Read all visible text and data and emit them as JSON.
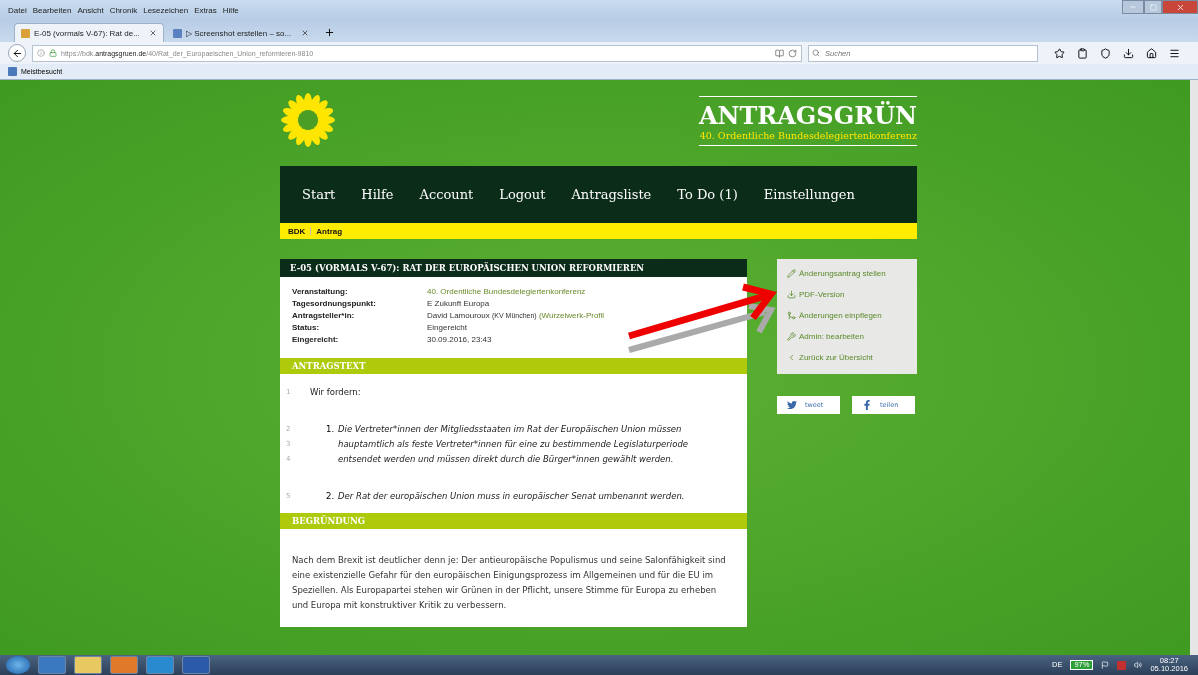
{
  "browser": {
    "menu": [
      "Datei",
      "Bearbeiten",
      "Ansicht",
      "Chronik",
      "Lesezeichen",
      "Extras",
      "Hilfe"
    ],
    "tabs": [
      {
        "label": "E-05 (vormals V-67): Rat de...",
        "selected": true
      },
      {
        "label": "▷ Screenshot erstellen – so...",
        "selected": false
      }
    ],
    "url": "https://bdk.**antragsgruen.de**/40/Rat_der_Europaeischen_Union_reformieren-9810",
    "search": {
      "placeholder": "Suchen"
    },
    "bookmarks": [
      "Meistbesucht"
    ]
  },
  "site": {
    "title": "ANTRAGSGRÜN",
    "subtitle": "40. Ordentliche Bundesdelegiertenkonferenz",
    "nav": [
      "Start",
      "Hilfe",
      "Account",
      "Logout",
      "Antragsliste",
      "To Do (1)",
      "Einstellungen"
    ],
    "breadcrumb": [
      "BDK",
      "Antrag"
    ],
    "motion": {
      "title": "E-05 (VORMALS V-67): RAT DER EUROPÄISCHEN UNION REFORMIEREN",
      "meta": [
        {
          "label": "Veranstaltung:",
          "value": "40. Ordentliche Bundesdelegiertenkonferenz",
          "kind": "link"
        },
        {
          "label": "Tagesordnungspunkt:",
          "value": "E Zukunft Europa",
          "kind": "text"
        },
        {
          "label": "Antragsteller*in:",
          "value": "David Lamouroux",
          "note": "(KV München)",
          "link": "(Wurzelwerk-Profil",
          "kind": "person"
        },
        {
          "label": "Status:",
          "value": "Eingereicht",
          "kind": "text"
        },
        {
          "label": "Eingereicht:",
          "value": "30.09.2016, 23:43",
          "kind": "text"
        }
      ],
      "text_heading": "ANTRAGSTEXT",
      "paragraphs": [
        {
          "kind": "plain",
          "lines": [
            {
              "number": "1",
              "text": "Wir fordern:"
            }
          ]
        },
        {
          "kind": "item",
          "marker": "1.",
          "lines": [
            {
              "number": "2",
              "text": "Die Vertreter*innen der Mitgliedsstaaten im Rat der Europäischen Union müssen"
            },
            {
              "number": "3",
              "text": "hauptamtlich als feste Vertreter*innen für eine zu bestimmende Legislaturperiode"
            },
            {
              "number": "4",
              "text": "entsendet werden und müssen direkt durch die Bürger*innen gewählt werden."
            }
          ]
        },
        {
          "kind": "item",
          "marker": "2.",
          "lines": [
            {
              "number": "5",
              "text": "Der Rat der europäischen Union muss in europäischer Senat umbenannt werden."
            }
          ]
        }
      ],
      "reason_heading": "BEGRÜNDUNG",
      "reason": "Nach dem Brexit ist deutlicher denn je: Der antieuropäische Populismus und seine Salonfähigkeit sind eine existenzielle Gefahr für den europäischen Einigungsprozess im Allgemeinen und für die EU im Speziellen. Als Europapartei stehen wir Grünen in der Pflicht, unsere Stimme für Europa zu erheben und Europa mit konstruktiver Kritik zu verbessern."
    },
    "actions": [
      {
        "label": "Änderungsantrag stellen",
        "kind": "amend"
      },
      {
        "label": "PDF-Version",
        "kind": "pdf"
      },
      {
        "label": "Änderungen einpflegen",
        "kind": "merge"
      },
      {
        "label": "Admin: bearbeiten",
        "kind": "admin"
      },
      {
        "label": "Zurück zur Übersicht",
        "kind": "back"
      }
    ],
    "share": [
      {
        "label": "tweet",
        "kind": "twitter"
      },
      {
        "label": "teilen",
        "kind": "facebook"
      }
    ]
  },
  "taskbar": {
    "language": "DE",
    "battery": "97%",
    "time": "08:27",
    "date": "05.10.2016"
  }
}
